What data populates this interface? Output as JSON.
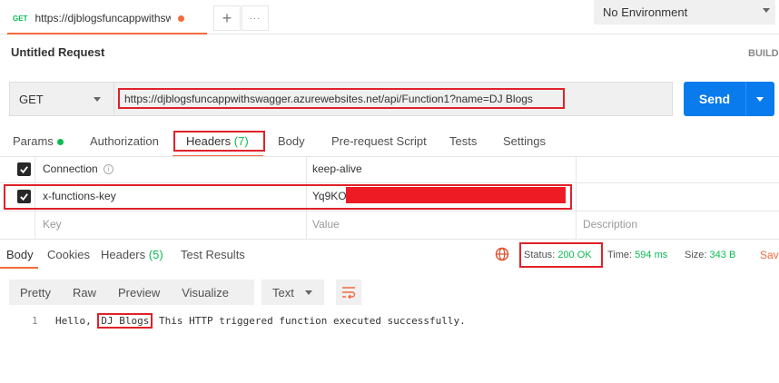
{
  "tab": {
    "method": "GET",
    "title": "https://djblogsfuncappwithswag..."
  },
  "tabbar": {
    "add_glyph": "+",
    "more_glyph": "···"
  },
  "environment": "No Environment",
  "request": {
    "title": "Untitled Request",
    "build_label": "BUILD"
  },
  "url_bar": {
    "method": "GET",
    "url": "https://djblogsfuncappwithswagger.azurewebsites.net/api/Function1?name=DJ Blogs",
    "send_label": "Send"
  },
  "request_tabs": [
    {
      "label": "Params"
    },
    {
      "label": "Authorization"
    },
    {
      "label": "Headers",
      "count": "(7)"
    },
    {
      "label": "Body"
    },
    {
      "label": "Pre-request Script"
    },
    {
      "label": "Tests"
    },
    {
      "label": "Settings"
    }
  ],
  "headers_table": {
    "rows": [
      {
        "key": "Connection",
        "value": "keep-alive",
        "checked": true,
        "info_glyph": "i"
      },
      {
        "key": "x-functions-key",
        "value": "Yq9KO",
        "checked": true,
        "value_redacted": true
      }
    ],
    "placeholders": {
      "key": "Key",
      "value": "Value",
      "description": "Description"
    }
  },
  "response_tabs": [
    {
      "label": "Body"
    },
    {
      "label": "Cookies"
    },
    {
      "label": "Headers",
      "count": "(5)"
    },
    {
      "label": "Test Results"
    }
  ],
  "response_meta": {
    "status_label": "Status:",
    "status_value": "200 OK",
    "time_label": "Time:",
    "time_value": "594 ms",
    "size_label": "Size:",
    "size_value": "343 B",
    "save_label": "Sav"
  },
  "body_toolbar": {
    "views": [
      "Pretty",
      "Raw",
      "Preview",
      "Visualize"
    ],
    "format": "Text"
  },
  "response_body": {
    "line_number": "1",
    "prefix": "Hello, ",
    "highlight": "DJ Blogs",
    "suffix": " This HTTP triggered function executed successfully."
  },
  "colors": {
    "accent": "#f26b3a",
    "send": "#097bed",
    "success": "#0cbb52",
    "annotation": "#e0222a"
  }
}
